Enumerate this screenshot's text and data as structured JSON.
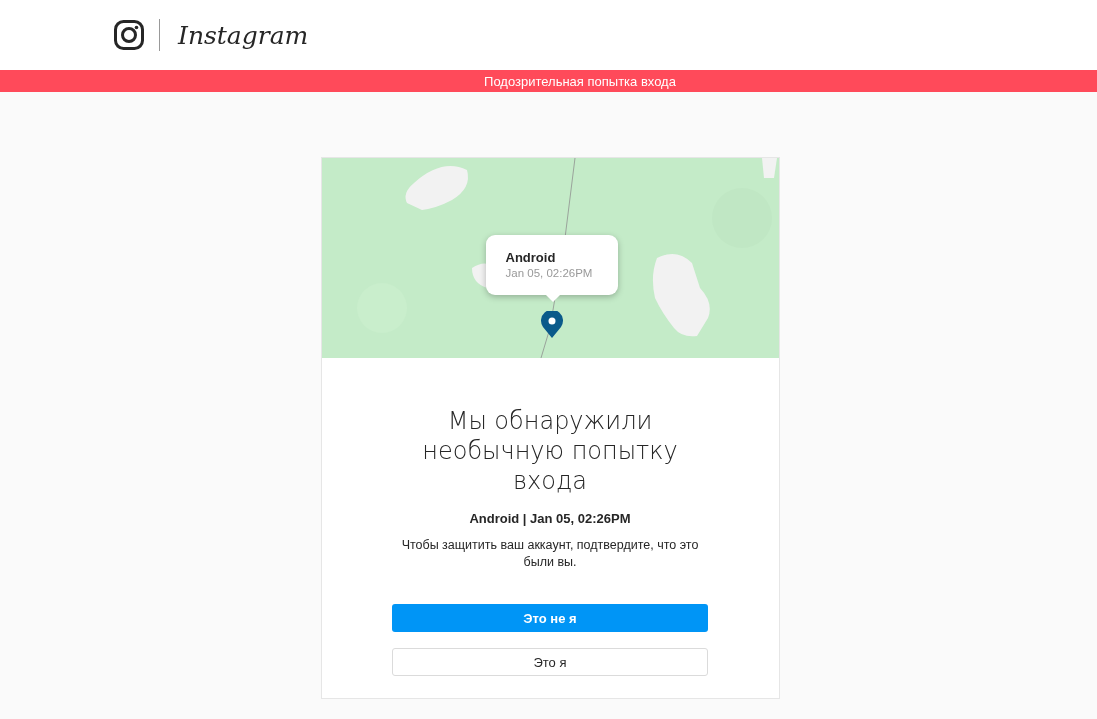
{
  "header": {
    "logo_text": "Instagram"
  },
  "banner": {
    "text": "Подозрительная попытка входа"
  },
  "map": {
    "kind": "picture",
    "popup": {
      "device": "Android",
      "time": "Jan 05, 02:26PM"
    }
  },
  "card": {
    "title": "Мы обнаружили необычную попытку входа",
    "device_line": "Android | Jan 05, 02:26PM",
    "message": "Чтобы защитить ваш аккаунт, подтвердите, что это были вы.",
    "buttons": [
      {
        "label": "Это не я",
        "kind": "primary"
      },
      {
        "label": "Это я",
        "kind": "secondary"
      }
    ]
  }
}
